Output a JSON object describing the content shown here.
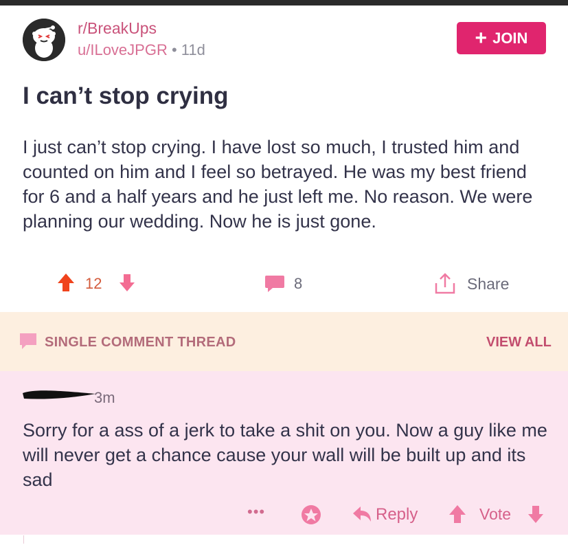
{
  "post": {
    "subreddit": "r/BreakUps",
    "author": "u/ILoveJPGR",
    "separator": "•",
    "age": "11d",
    "join_label": "JOIN",
    "join_plus": "+",
    "title": "I can’t stop crying",
    "body": "I just can’t stop crying. I have lost so much, I trusted him and counted on him and I feel so betrayed. He was my best friend for 6 and a half years and he just left me. No reason. We were planning our wedding. Now he is just gone.",
    "score": "12",
    "comment_count": "8",
    "share_label": "Share"
  },
  "thread": {
    "label": "SINGLE COMMENT THREAD",
    "view_all": "VIEW ALL"
  },
  "comment": {
    "age": "3m",
    "text": "Sorry for a ass of a jerk to take a shit on you. Now a guy like me will never get a chance cause your wall will be built up and its sad",
    "more": "•••",
    "reply_label": "Reply",
    "vote_label": "Vote"
  },
  "colors": {
    "join_bg": "#e0256e",
    "upvote": "#f0431c",
    "downvote": "#f36d93",
    "thread_bg": "#fdefe0",
    "comment_bg": "#fce5f0"
  },
  "icons": [
    "snoo-avatar-icon",
    "plus-icon",
    "upvote-arrow-icon",
    "downvote-arrow-icon",
    "comment-bubble-icon",
    "share-icon",
    "more-dots-icon",
    "award-icon",
    "reply-arrow-icon"
  ]
}
